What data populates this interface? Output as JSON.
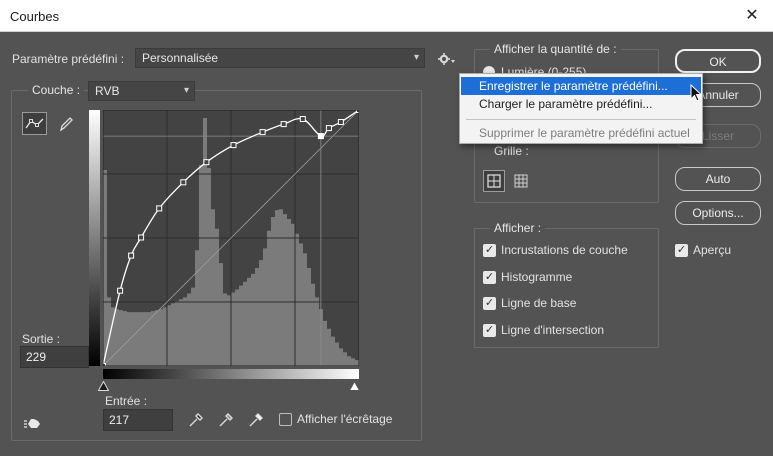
{
  "window": {
    "title": "Courbes",
    "close_glyph": "✕"
  },
  "preset": {
    "label": "Paramètre prédéfini :",
    "value": "Personnalisée"
  },
  "channel": {
    "label": "Couche :",
    "value": "RVB"
  },
  "output": {
    "label": "Sortie :",
    "value": "229"
  },
  "input": {
    "label": "Entrée :",
    "value": "217"
  },
  "clipping": {
    "label": "Afficher l'écrêtage",
    "checked": false
  },
  "show_amount": {
    "title": "Afficher la quantité de :",
    "option1": "Lumière (0-255)",
    "grid_label": "Grille :"
  },
  "display": {
    "title": "Afficher :",
    "options": [
      {
        "label": "Incrustations de couche",
        "checked": true
      },
      {
        "label": "Histogramme",
        "checked": true
      },
      {
        "label": "Ligne de base",
        "checked": true
      },
      {
        "label": "Ligne d'intersection",
        "checked": true
      }
    ]
  },
  "buttons": {
    "ok": "OK",
    "cancel": "Annuler",
    "smooth": "Lisser",
    "auto": "Auto",
    "options": "Options..."
  },
  "preview": {
    "label": "Aperçu",
    "checked": true
  },
  "menu": {
    "items": [
      {
        "label": "Enregistrer le paramètre prédéfini...",
        "state": "active"
      },
      {
        "label": "Charger le paramètre prédéfini...",
        "state": "normal"
      },
      {
        "label": "Supprimer le paramètre prédéfini actuel",
        "state": "disabled"
      }
    ]
  },
  "chart_data": {
    "type": "line",
    "xlim": [
      0,
      255
    ],
    "ylim": [
      0,
      255
    ],
    "curve_points": [
      [
        0,
        0
      ],
      [
        17,
        75
      ],
      [
        28,
        110
      ],
      [
        38,
        128
      ],
      [
        56,
        157
      ],
      [
        80,
        183
      ],
      [
        103,
        203
      ],
      [
        130,
        220
      ],
      [
        159,
        233
      ],
      [
        180,
        241
      ],
      [
        199,
        246
      ],
      [
        217,
        229
      ],
      [
        225,
        237
      ],
      [
        237,
        243
      ],
      [
        255,
        255
      ]
    ],
    "histogram": [
      200,
      70,
      60,
      58,
      57,
      56,
      55,
      55,
      55,
      55,
      55,
      55,
      56,
      57,
      58,
      60,
      62,
      64,
      66,
      68,
      70,
      74,
      80,
      118,
      205,
      253,
      202,
      160,
      140,
      105,
      74,
      72,
      75,
      78,
      82,
      86,
      90,
      94,
      100,
      108,
      120,
      138,
      152,
      159,
      160,
      155,
      150,
      145,
      135,
      125,
      115,
      100,
      84,
      70,
      58,
      46,
      38,
      30,
      24,
      18,
      14,
      10,
      8,
      6
    ]
  }
}
